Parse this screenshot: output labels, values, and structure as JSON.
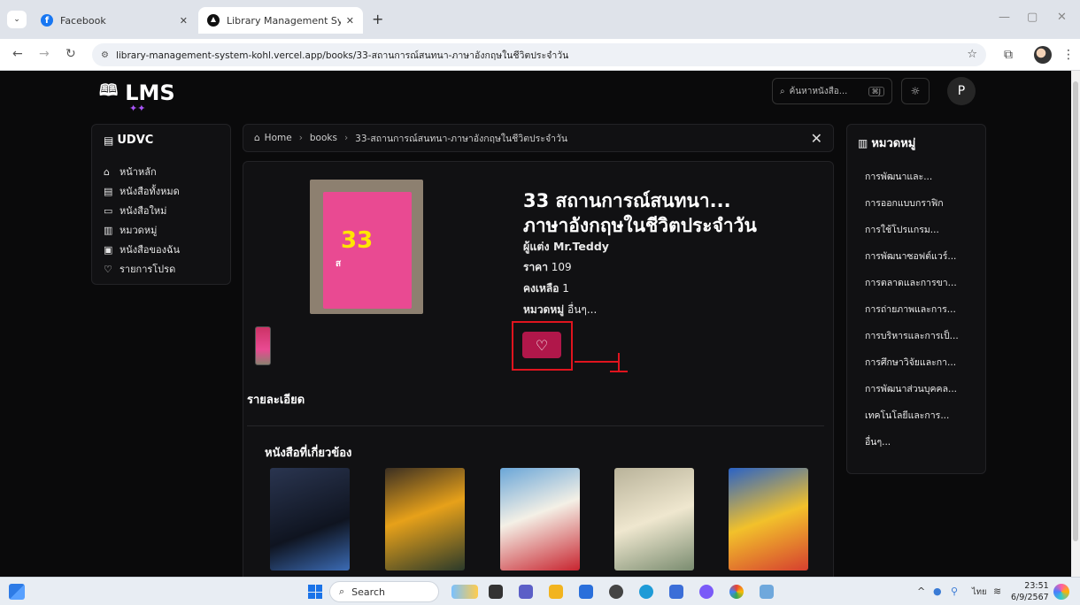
{
  "browser": {
    "tabs": [
      {
        "title": "Facebook",
        "active": false
      },
      {
        "title": "Library Management System",
        "active": true
      }
    ],
    "new_tab": "+",
    "url": "library-management-system-kohl.vercel.app/books/33-สถานการณ์สนทนา-ภาษาอังกฤษในชีวิตประจำวัน"
  },
  "header": {
    "logo": "LMS",
    "search_placeholder": "ค้นหาหนังสือ...",
    "search_shortcut": "⌘J",
    "avatar_initial": "P"
  },
  "sidebar": {
    "title": "UDVC",
    "items": [
      {
        "label": "หน้าหลัก",
        "icon": "home-icon"
      },
      {
        "label": "หนังสือทั้งหมด",
        "icon": "books-icon"
      },
      {
        "label": "หนังสือใหม่",
        "icon": "new-book-icon"
      },
      {
        "label": "หมวดหมู่",
        "icon": "category-icon"
      },
      {
        "label": "หนังสือของฉัน",
        "icon": "my-books-icon"
      },
      {
        "label": "รายการโปรด",
        "icon": "heart-icon"
      }
    ]
  },
  "breadcrumb": {
    "items": [
      "Home",
      "books",
      "33-สถานการณ์สนทนา-ภาษาอังกฤษในชีวิตประจำวัน"
    ]
  },
  "book": {
    "title_line1": "33 สถานการณ์สนทนา...",
    "title_line2": "ภาษาอังกฤษในชีวิตประจำวัน",
    "author_label": "ผู้แต่ง",
    "author": "Mr.Teddy",
    "price_label": "ราคา",
    "price": "109",
    "stock_label": "คงเหลือ",
    "stock": "1",
    "category_label": "หมวดหมู่",
    "category": "อื่นๆ..."
  },
  "sections": {
    "details": "รายละเอียด",
    "related": "หนังสือที่เกี่ยวข้อง"
  },
  "categories": {
    "title": "หมวดหมู่",
    "items": [
      "การพัฒนาและ...",
      "การออกแบบกราฟิก",
      "การใช้โปรแกรม...",
      "การพัฒนาซอฟต์แวร์...",
      "การตลาดและการขา...",
      "การถ่ายภาพและการ...",
      "การบริหารและการเป็...",
      "การศึกษาวิจัยและกา...",
      "การพัฒนาส่วนบุคคล...",
      "เทคโนโลยีและการ...",
      "อื่นๆ..."
    ]
  },
  "taskbar": {
    "search": "Search",
    "lang": "ไทย",
    "time": "23:51",
    "date": "6/9/2567"
  },
  "colors": {
    "accent": "#b0174a",
    "annotation": "#e0141e",
    "page_bg": "#0a0a0b"
  }
}
